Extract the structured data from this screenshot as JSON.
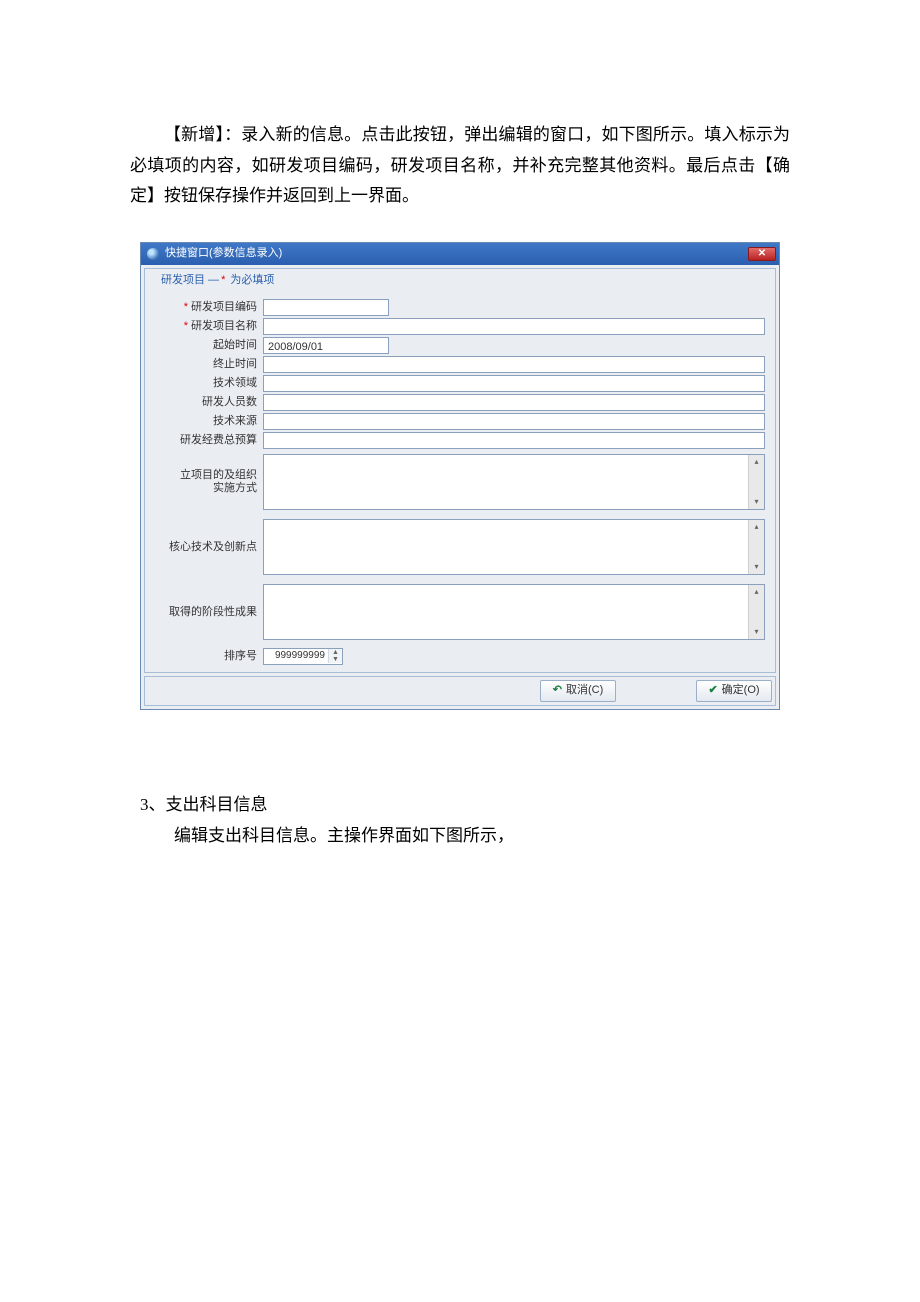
{
  "intro": {
    "line1": "【新增】：录入新的信息。点击此按钮，弹出编辑的窗口，如下图所示。填入标示为必填项的内容，如研发项目编码，研发项目名称，并补充完整其他资料。最后点击【确定】按钮保存操作并返回到上一界面。"
  },
  "dialog": {
    "title": "快捷窗口(参数信息录入)",
    "legend_prefix": "研发项目 —",
    "legend_star": "*",
    "legend_suffix": " 为必填项",
    "labels": {
      "code": "研发项目编码",
      "name": "研发项目名称",
      "start": "起始时间",
      "end": "终止时间",
      "tech_field": "技术领域",
      "staff": "研发人员数",
      "tech_source": "技术来源",
      "budget": "研发经费总预算",
      "purpose": "立项目的及组织\n实施方式",
      "core": "核心技术及创新点",
      "results": "取得的阶段性成果",
      "order": "排序号"
    },
    "values": {
      "start": "2008/09/01",
      "order": "999999999"
    },
    "buttons": {
      "cancel": "取消(C)",
      "ok": "确定(O)"
    }
  },
  "section3": {
    "title": "3、支出科目信息",
    "body": "编辑支出科目信息。主操作界面如下图所示，"
  }
}
